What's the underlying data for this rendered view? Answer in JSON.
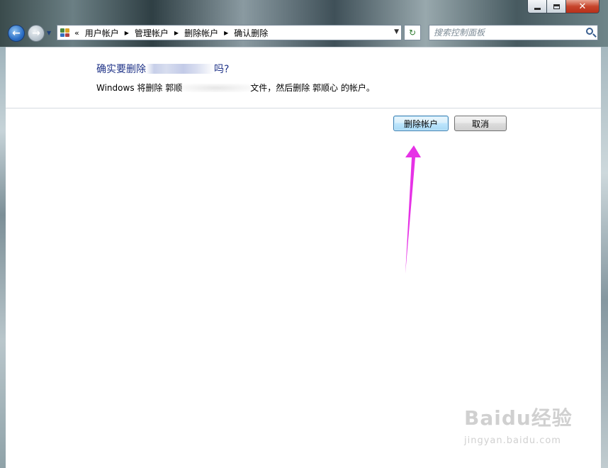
{
  "window": {
    "close_glyph": "✕"
  },
  "address_bar": {
    "overflow": "«",
    "breadcrumbs": [
      "用户帐户",
      "管理帐户",
      "删除帐户",
      "确认删除"
    ],
    "separator": "▶",
    "dropdown_glyph": "▼"
  },
  "search": {
    "placeholder": "搜索控制面板"
  },
  "dialog": {
    "heading_prefix": "确实要删除",
    "heading_suffix": "吗?",
    "description_prefix": "Windows 将删除 郭顺",
    "description_suffix": "文件，然后删除 郭顺心 的帐户。"
  },
  "buttons": {
    "delete_label": "删除帐户",
    "cancel_label": "取消"
  },
  "annotation": {
    "arrow_color": "#e632e6"
  },
  "watermark": {
    "brand": "Baidu经验",
    "url": "jingyan.baidu.com"
  }
}
